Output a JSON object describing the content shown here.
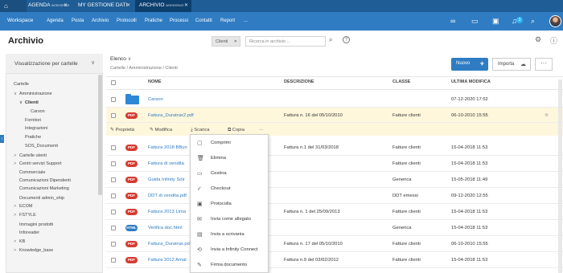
{
  "tabs": [
    {
      "label": "AGENDA",
      "sub": "WORKSPACE"
    },
    {
      "label": "MY GESTIONE DATI",
      "sub": ""
    },
    {
      "label": "ARCHIVIO",
      "sub": "WORKSPACE"
    }
  ],
  "nav": {
    "brand": "Workspace",
    "items": [
      "Agenda",
      "Posta",
      "Archivio",
      "Protocolli",
      "Pratiche",
      "Processi",
      "Contatti",
      "Report"
    ],
    "more": "...",
    "badge": "3"
  },
  "page": {
    "title": "Archivio",
    "chip": "Clienti",
    "search_placeholder": "Ricerca in archivio ..."
  },
  "sidebar": {
    "view_label": "Visualizzazione per cartelle",
    "tree": [
      {
        "label": "Cartelle",
        "indent": 0,
        "arrow": ""
      },
      {
        "label": "Amministrazione",
        "indent": 1,
        "arrow": "∨"
      },
      {
        "label": "Clienti",
        "indent": 2,
        "arrow": "∨",
        "bold": true
      },
      {
        "label": "Carson",
        "indent": 3,
        "arrow": ""
      },
      {
        "label": "Fornitori",
        "indent": 2,
        "arrow": ""
      },
      {
        "label": "Integrazioni",
        "indent": 2,
        "arrow": ""
      },
      {
        "label": "Pratiche",
        "indent": 2,
        "arrow": ""
      },
      {
        "label": "SOS_Documenti",
        "indent": 2,
        "arrow": ""
      },
      {
        "label": "Cartelle utenti",
        "indent": 1,
        "arrow": ">"
      },
      {
        "label": "Centri servizi Support",
        "indent": 1,
        "arrow": ">"
      },
      {
        "label": "Commerciale",
        "indent": 1,
        "arrow": ""
      },
      {
        "label": "Comunicazioni Dipendenti",
        "indent": 1,
        "arrow": ""
      },
      {
        "label": "Comunicazioni Marketing",
        "indent": 1,
        "arrow": ""
      },
      {
        "label": "Documenti admin_ship",
        "indent": 1,
        "arrow": ""
      },
      {
        "label": "ECOM",
        "indent": 1,
        "arrow": ">"
      },
      {
        "label": "FSTYLE",
        "indent": 1,
        "arrow": ">"
      },
      {
        "label": "Immagini prodotti",
        "indent": 1,
        "arrow": ""
      },
      {
        "label": "Inforeader",
        "indent": 1,
        "arrow": ""
      },
      {
        "label": "KB",
        "indent": 1,
        "arrow": ">"
      },
      {
        "label": "Knowledge_base",
        "indent": 1,
        "arrow": ">"
      }
    ]
  },
  "content": {
    "view_title": "Elenco",
    "breadcrumb": "Cartelle / Amministrazione / Clienti",
    "new_button": "Nuovo",
    "import_button": "Importa",
    "more_button": "···",
    "headers": {
      "name": "NOME",
      "desc": "DESCRIZIONE",
      "class": "CLASSE",
      "modified": "ULTIMA MODIFICA"
    },
    "rows": [
      {
        "type": "folder",
        "name": "Carson",
        "desc": "",
        "class": "",
        "date": "07-12-2020 17:52"
      },
      {
        "type": "PDF",
        "name": "Fattura_Duratrax2.pdf",
        "desc": "Fattura n. 16 del 05/10/2010",
        "class": "Fatture clienti",
        "date": "06-10-2010 15:55",
        "selected": true
      },
      {
        "type": "PDF",
        "name": "Fattura 2018 BBun",
        "desc": "Fattura n.1 del 31/03/2018",
        "class": "Fatture clienti",
        "date": "15-04-2018 11:53"
      },
      {
        "type": "PDF",
        "name": "Fattura di vendita",
        "desc": "",
        "class": "Fatture clienti",
        "date": "15-04-2018 11:53"
      },
      {
        "type": "PDF",
        "name": "Guida Infinity Solr",
        "desc": "",
        "class": "Generica",
        "date": "15-05-2018 11:49"
      },
      {
        "type": "PDF",
        "name": "DDT di vendita.pdf",
        "desc": "",
        "class": "DDT emessi",
        "date": "09-12-2020 12:55"
      },
      {
        "type": "PDF",
        "name": "Fattura 2013 Lima",
        "desc": "Fattura n. 1 del 25/09/2013",
        "class": "Fatture clienti",
        "date": "15-04-2018 11:53"
      },
      {
        "type": "HTML",
        "name": "Verifica doc.html",
        "desc": "",
        "class": "Generica",
        "date": "15-04-2018 11:53"
      },
      {
        "type": "PDF",
        "name": "Fattura_Duratrax.pd",
        "desc": "Fattura n. 17 del 05/10/2010",
        "class": "Fatture clienti",
        "date": "06-10-2010 15:55"
      },
      {
        "type": "PDF",
        "name": "Fattura 2012 Amat",
        "desc": "Fattura n.9 del 03/02/2012",
        "class": "Fatture clienti",
        "date": "15-04-2018 11:53"
      }
    ],
    "actions": [
      "Proprietà",
      "Modifica",
      "Scarica",
      "Copia",
      "···"
    ],
    "menu": [
      {
        "icon": "▢",
        "label": "Comprimi"
      },
      {
        "icon": "🗑",
        "label": "Elimina"
      },
      {
        "icon": "▭",
        "label": "Cestina"
      },
      {
        "icon": "✓",
        "label": "Checkout"
      },
      {
        "icon": "▣",
        "label": "Protocolla"
      },
      {
        "icon": "✉",
        "label": "Invia come allegato"
      },
      {
        "icon": "▤",
        "label": "Invia a scrivania"
      },
      {
        "icon": "⟲",
        "label": "Invia a Infinity Connect"
      },
      {
        "icon": "✎",
        "label": "Firma documento"
      }
    ]
  },
  "colors": {
    "nav": "#2f7cc3",
    "tabbar": "#1f5d96",
    "pdf": "#d53b2f",
    "selected_row": "#fff7dc"
  }
}
